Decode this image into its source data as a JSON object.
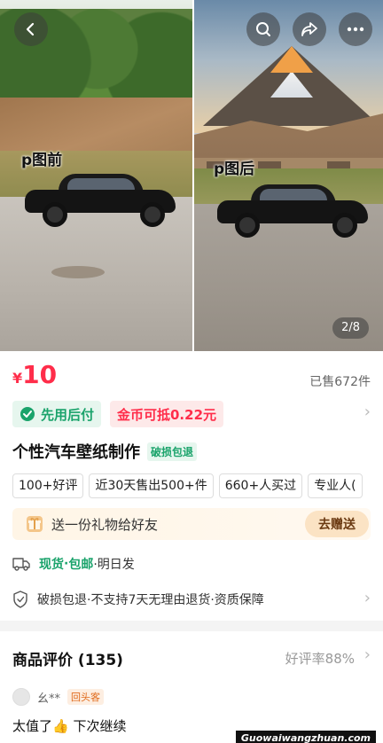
{
  "hero": {
    "before_label": "p图前",
    "after_label": "p图后",
    "counter": "2/8"
  },
  "icons": {
    "back": "back-arrow-icon",
    "search": "search-icon",
    "share": "share-icon",
    "more": "more-dots-icon"
  },
  "product": {
    "currency": "¥",
    "price": "10",
    "sold": "已售672件",
    "pay_later": "先用后付",
    "coin_discount": "金币可抵0.22元",
    "title": "个性汽车壁纸制作",
    "title_tag": "破损包退",
    "chips": [
      "100+好评",
      "近30天售出500+件",
      "660+人买过",
      "专业人("
    ],
    "gift_text": "送一份礼物给好友",
    "gift_button": "去赠送",
    "delivery_stock": "现货",
    "delivery_sep": "·",
    "delivery_free": "包邮",
    "delivery_rest": "·明日发",
    "guarantee": "破损包退·不支持7天无理由退货·资质保障"
  },
  "reviews": {
    "title": "商品评价 (135)",
    "rate": "好评率88%",
    "user": "幺**",
    "user_badge": "回头客",
    "text": "太值了👍 下次继续"
  },
  "watermark": "Guowaiwangzhuan.com",
  "colors": {
    "price": "#ff2d4a",
    "green": "#1aa36b",
    "gift_button": "#fbe3c4"
  }
}
